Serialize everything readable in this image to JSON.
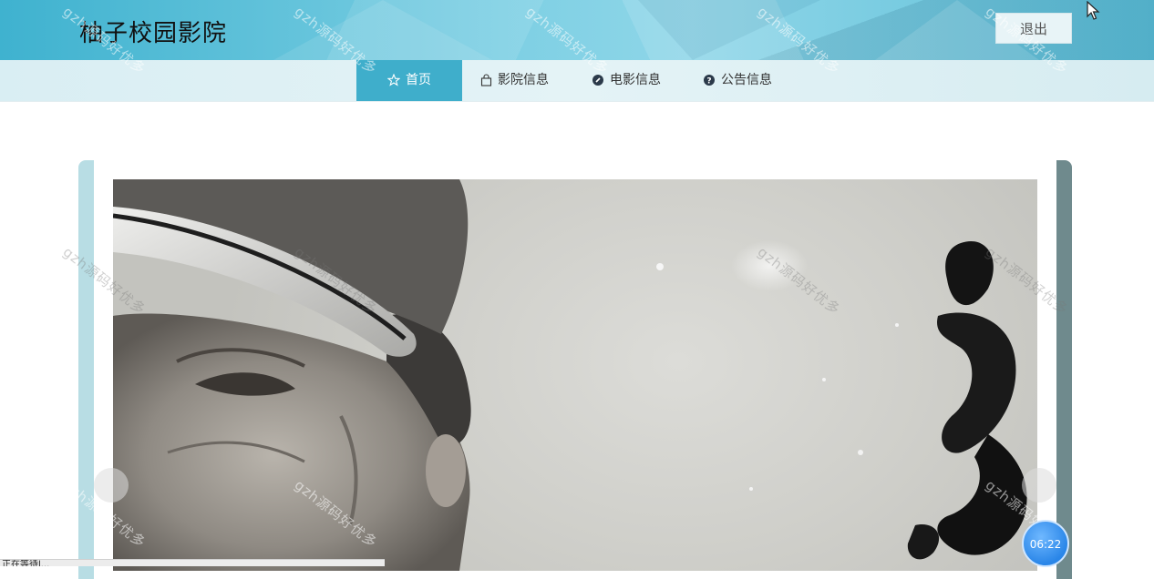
{
  "header": {
    "site_title": "柚子校园影院",
    "logout_label": "退出"
  },
  "nav": {
    "items": [
      {
        "label": "首页",
        "icon": "star-icon"
      },
      {
        "label": "影院信息",
        "icon": "bag-icon"
      },
      {
        "label": "电影信息",
        "icon": "info-circle-icon"
      },
      {
        "label": "公告信息",
        "icon": "question-circle-icon"
      }
    ],
    "active_index": 0
  },
  "carousel": {
    "prev_icon": "chevron-left-icon",
    "next_icon": "chevron-right-icon"
  },
  "timer": {
    "text": "06:22"
  },
  "watermark": {
    "text": "gzh源码好优多"
  },
  "status_bar": {
    "text": "正在等待l..."
  },
  "colors": {
    "header_accent": "#3fb2cf",
    "nav_active": "#3faecb",
    "nav_bg": "#dff0f4",
    "frame_left": "#b8dde4",
    "frame_right": "#6f8a8d"
  }
}
